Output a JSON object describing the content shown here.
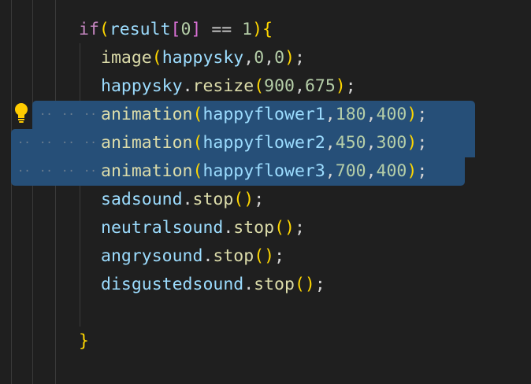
{
  "editor": {
    "code_lines": [
      {
        "tokens": [
          {
            "t": "if",
            "c": "kw"
          },
          {
            "t": "(",
            "c": "br1"
          },
          {
            "t": "result",
            "c": "var"
          },
          {
            "t": "[",
            "c": "br2"
          },
          {
            "t": "0",
            "c": "num"
          },
          {
            "t": "]",
            "c": "br2"
          },
          {
            "t": " == ",
            "c": "pun"
          },
          {
            "t": "1",
            "c": "num"
          },
          {
            "t": ")",
            "c": "br1"
          },
          {
            "t": "{",
            "c": "br1"
          }
        ]
      },
      {
        "tokens": [
          {
            "t": "image",
            "c": "fn"
          },
          {
            "t": "(",
            "c": "br1"
          },
          {
            "t": "happysky",
            "c": "var"
          },
          {
            "t": ",",
            "c": "pun"
          },
          {
            "t": "0",
            "c": "num"
          },
          {
            "t": ",",
            "c": "pun"
          },
          {
            "t": "0",
            "c": "num"
          },
          {
            "t": ")",
            "c": "br1"
          },
          {
            "t": ";",
            "c": "pun"
          }
        ]
      },
      {
        "tokens": [
          {
            "t": "happysky",
            "c": "var"
          },
          {
            "t": ".",
            "c": "pun"
          },
          {
            "t": "resize",
            "c": "fn"
          },
          {
            "t": "(",
            "c": "br1"
          },
          {
            "t": "900",
            "c": "num"
          },
          {
            "t": ",",
            "c": "pun"
          },
          {
            "t": "675",
            "c": "num"
          },
          {
            "t": ")",
            "c": "br1"
          },
          {
            "t": ";",
            "c": "pun"
          }
        ]
      },
      {
        "tokens": [
          {
            "t": "animation",
            "c": "fn"
          },
          {
            "t": "(",
            "c": "br1"
          },
          {
            "t": "happyflower1",
            "c": "var"
          },
          {
            "t": ",",
            "c": "pun"
          },
          {
            "t": "180",
            "c": "num"
          },
          {
            "t": ",",
            "c": "pun"
          },
          {
            "t": "400",
            "c": "num"
          },
          {
            "t": ")",
            "c": "br1"
          },
          {
            "t": ";",
            "c": "pun"
          }
        ]
      },
      {
        "tokens": [
          {
            "t": "animation",
            "c": "fn"
          },
          {
            "t": "(",
            "c": "br1"
          },
          {
            "t": "happyflower2",
            "c": "var"
          },
          {
            "t": ",",
            "c": "pun"
          },
          {
            "t": "450",
            "c": "num"
          },
          {
            "t": ",",
            "c": "pun"
          },
          {
            "t": "300",
            "c": "num"
          },
          {
            "t": ")",
            "c": "br1"
          },
          {
            "t": ";",
            "c": "pun"
          }
        ]
      },
      {
        "tokens": [
          {
            "t": "animation",
            "c": "fn"
          },
          {
            "t": "(",
            "c": "br1"
          },
          {
            "t": "happyflower3",
            "c": "var"
          },
          {
            "t": ",",
            "c": "pun"
          },
          {
            "t": "700",
            "c": "num"
          },
          {
            "t": ",",
            "c": "pun"
          },
          {
            "t": "400",
            "c": "num"
          },
          {
            "t": ")",
            "c": "br1"
          },
          {
            "t": ";",
            "c": "pun"
          }
        ]
      },
      {
        "tokens": [
          {
            "t": "sadsound",
            "c": "var"
          },
          {
            "t": ".",
            "c": "pun"
          },
          {
            "t": "stop",
            "c": "fn"
          },
          {
            "t": "(",
            "c": "br1"
          },
          {
            "t": ")",
            "c": "br1"
          },
          {
            "t": ";",
            "c": "pun"
          }
        ]
      },
      {
        "tokens": [
          {
            "t": "neutralsound",
            "c": "var"
          },
          {
            "t": ".",
            "c": "pun"
          },
          {
            "t": "stop",
            "c": "fn"
          },
          {
            "t": "(",
            "c": "br1"
          },
          {
            "t": ")",
            "c": "br1"
          },
          {
            "t": ";",
            "c": "pun"
          }
        ]
      },
      {
        "tokens": [
          {
            "t": "angrysound",
            "c": "var"
          },
          {
            "t": ".",
            "c": "pun"
          },
          {
            "t": "stop",
            "c": "fn"
          },
          {
            "t": "(",
            "c": "br1"
          },
          {
            "t": ")",
            "c": "br1"
          },
          {
            "t": ";",
            "c": "pun"
          }
        ]
      },
      {
        "tokens": [
          {
            "t": "disgustedsound",
            "c": "var"
          },
          {
            "t": ".",
            "c": "pun"
          },
          {
            "t": "stop",
            "c": "fn"
          },
          {
            "t": "(",
            "c": "br1"
          },
          {
            "t": ")",
            "c": "br1"
          },
          {
            "t": ";",
            "c": "pun"
          }
        ]
      },
      {
        "tokens": []
      },
      {
        "tokens": [
          {
            "t": "}",
            "c": "br1"
          }
        ]
      }
    ],
    "selected_lines": [
      3,
      4,
      5
    ],
    "whitespace_marker": "··",
    "lightbulb_icon": "lightbulb-icon",
    "colors": {
      "background": "#1f1f1f",
      "selection": "#264f78",
      "keyword": "#c586c0",
      "function": "#dcdcaa",
      "variable": "#9cdcfe",
      "number": "#b5cea8",
      "punctuation": "#d4d4d4",
      "bracket_1": "#ffd700",
      "bracket_2": "#da70d6",
      "lightbulb": "#ffcc00"
    }
  }
}
